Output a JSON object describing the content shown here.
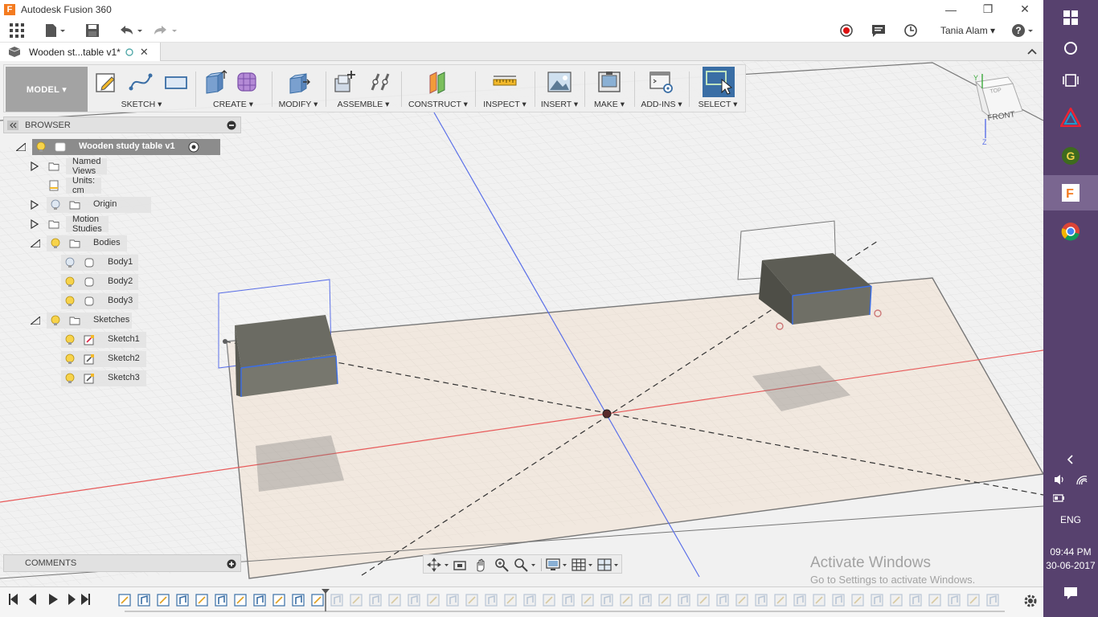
{
  "window": {
    "title": "Autodesk Fusion 360",
    "minimize": "—",
    "restore": "❐",
    "close": "✕"
  },
  "qat": {
    "user": "Tania Alam",
    "help": "?"
  },
  "document_tab": {
    "label": "Wooden st...table v1*"
  },
  "ribbon": {
    "workspace": "MODEL ▾",
    "groups": [
      {
        "label": "SKETCH ▾"
      },
      {
        "label": "CREATE ▾"
      },
      {
        "label": "MODIFY ▾"
      },
      {
        "label": "ASSEMBLE ▾"
      },
      {
        "label": "CONSTRUCT ▾"
      },
      {
        "label": "INSPECT ▾"
      },
      {
        "label": "INSERT ▾"
      },
      {
        "label": "MAKE ▾"
      },
      {
        "label": "ADD-INS ▾"
      },
      {
        "label": "SELECT ▾"
      }
    ]
  },
  "browser": {
    "title": "BROWSER",
    "items": [
      {
        "label": "Wooden study table v1"
      },
      {
        "label": "Named Views"
      },
      {
        "label": "Units: cm"
      },
      {
        "label": "Origin"
      },
      {
        "label": "Motion Studies"
      },
      {
        "label": "Bodies"
      },
      {
        "label": "Body1"
      },
      {
        "label": "Body2"
      },
      {
        "label": "Body3"
      },
      {
        "label": "Sketches"
      },
      {
        "label": "Sketch1"
      },
      {
        "label": "Sketch2"
      },
      {
        "label": "Sketch3"
      }
    ]
  },
  "comments": {
    "title": "COMMENTS"
  },
  "viewcube": {
    "face": "FRONT",
    "top_face": "TOP",
    "axis_y": "Y",
    "axis_z": "Z"
  },
  "watermark": {
    "title": "Activate Windows",
    "subtitle": "Go to Settings to activate Windows."
  },
  "taskbar": {
    "language": "ENG",
    "time": "09:44 PM",
    "date": "30-06-2017"
  },
  "colors": {
    "accent_blue": "#3a6ea5",
    "axis_red": "#e85a5a",
    "axis_blue": "#5a6fe8",
    "taskbar": "#57416e"
  }
}
